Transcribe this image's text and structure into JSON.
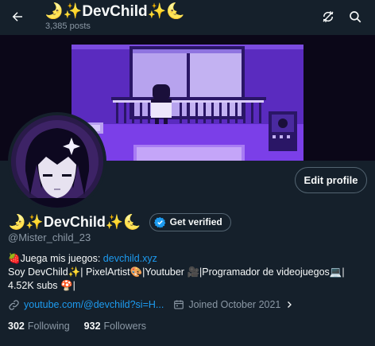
{
  "header": {
    "title": "🌛✨DevChild✨🌜",
    "post_count": "3,385 posts",
    "back_icon": "arrow-left-icon",
    "refresh_icon": "refresh-slash-icon",
    "search_icon": "search-icon"
  },
  "profile": {
    "display_name": "🌛✨DevChild✨🌜",
    "verify_label": "Get verified",
    "handle": "@Mister_child_23",
    "edit_label": "Edit profile",
    "bio_prefix": "🍓Juega mis juegos: ",
    "bio_link": "devchild.xyz",
    "bio_text": "Soy DevChild✨| PixelArtist🎨|Youtuber 🎥|Programador de videojuegos💻| 4.52K subs 🍄|",
    "website": "youtube.com/@devchild?si=H...",
    "joined": "Joined October 2021",
    "following_count": "302",
    "following_label": "Following",
    "followers_count": "932",
    "followers_label": "Followers"
  },
  "colors": {
    "background": "#15202b",
    "accent": "#1d9bf0",
    "muted": "#8b98a5",
    "banner_purple": "#6a2fd6"
  }
}
